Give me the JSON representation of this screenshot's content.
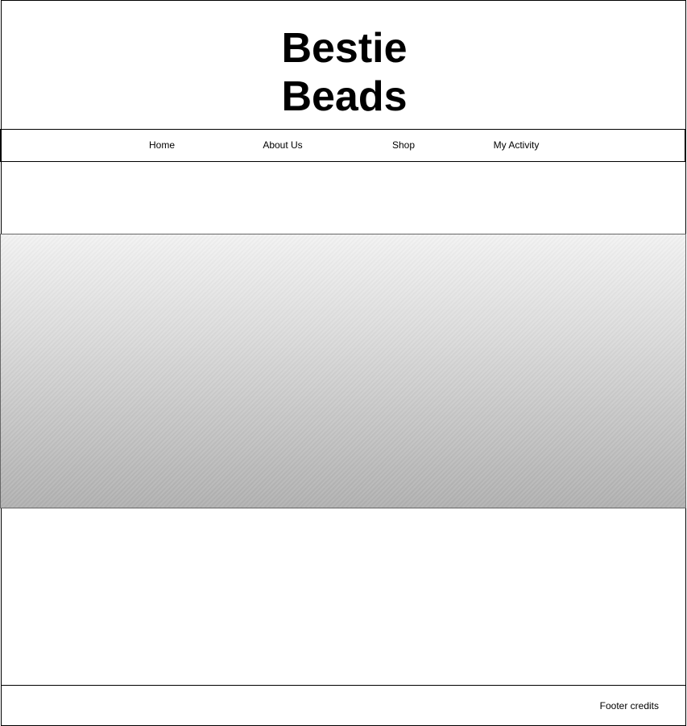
{
  "header": {
    "title_line1": "Bestie",
    "title_line2": "Beads"
  },
  "nav": {
    "items": [
      {
        "label": "Home"
      },
      {
        "label": "About Us"
      },
      {
        "label": "Shop"
      },
      {
        "label": "My Activity"
      }
    ]
  },
  "hero": {
    "fill": "gradient-placeholder"
  },
  "footer": {
    "credits": "Footer credits"
  },
  "colors": {
    "border": "#000000",
    "background": "#ffffff",
    "hero_top": "#f2f2f2",
    "hero_bottom": "#b0b0b0"
  }
}
